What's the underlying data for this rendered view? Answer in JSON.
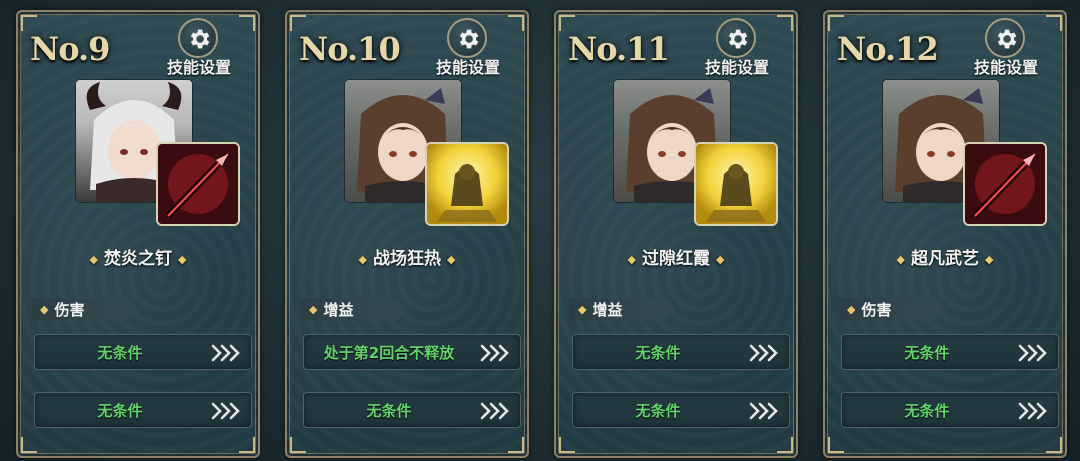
{
  "skill_settings_label": "技能设置",
  "cards": [
    {
      "number": "No.9",
      "skill_name": "焚炎之钉",
      "type": "伤害",
      "conditions": [
        "无条件",
        "无条件"
      ],
      "icon": "red-spear-icon",
      "portrait": "white-haired-horned-character-portrait"
    },
    {
      "number": "No.10",
      "skill_name": "战场狂热",
      "type": "增益",
      "conditions": [
        "处于第2回合不释放",
        "无条件"
      ],
      "icon": "golden-warrior-buff-icon",
      "portrait": "brown-haired-character-portrait"
    },
    {
      "number": "No.11",
      "skill_name": "过隙红霞",
      "type": "增益",
      "conditions": [
        "无条件",
        "无条件"
      ],
      "icon": "golden-warrior-buff-icon",
      "portrait": "brown-haired-character-portrait"
    },
    {
      "number": "No.12",
      "skill_name": "超凡武艺",
      "type": "伤害",
      "conditions": [
        "无条件",
        "无条件"
      ],
      "icon": "red-spear-icon",
      "portrait": "brown-haired-character-portrait"
    }
  ],
  "colors": {
    "condition_text": "#63d36b",
    "number_text": "#e6d7a8",
    "spark": "#e9c76a"
  }
}
